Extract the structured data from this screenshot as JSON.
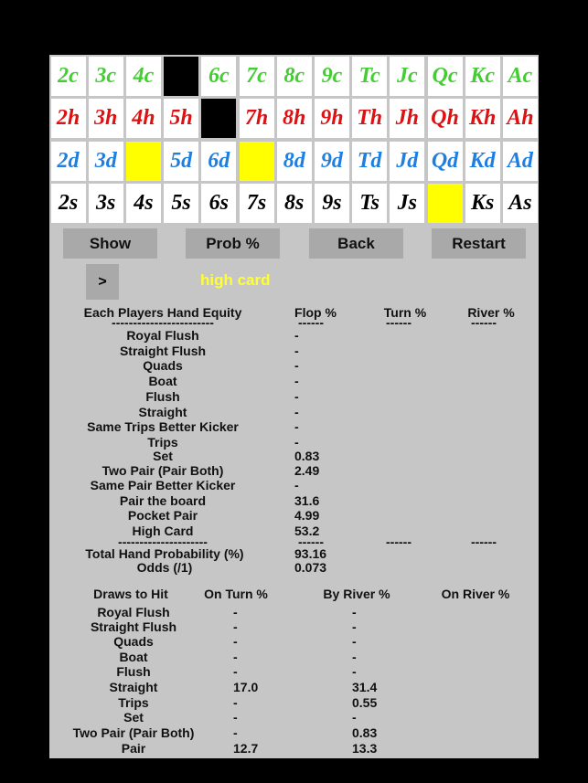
{
  "cards": [
    {
      "label": "2c",
      "color": "#44cc33",
      "state": "normal"
    },
    {
      "label": "3c",
      "color": "#44cc33",
      "state": "normal"
    },
    {
      "label": "4c",
      "color": "#44cc33",
      "state": "normal"
    },
    {
      "label": "",
      "color": "#44cc33",
      "state": "black"
    },
    {
      "label": "6c",
      "color": "#44cc33",
      "state": "normal"
    },
    {
      "label": "7c",
      "color": "#44cc33",
      "state": "normal"
    },
    {
      "label": "8c",
      "color": "#44cc33",
      "state": "normal"
    },
    {
      "label": "9c",
      "color": "#44cc33",
      "state": "normal"
    },
    {
      "label": "Tc",
      "color": "#44cc33",
      "state": "normal"
    },
    {
      "label": "Jc",
      "color": "#44cc33",
      "state": "normal"
    },
    {
      "label": "Qc",
      "color": "#44cc33",
      "state": "normal"
    },
    {
      "label": "Kc",
      "color": "#44cc33",
      "state": "normal"
    },
    {
      "label": "Ac",
      "color": "#44cc33",
      "state": "normal"
    },
    {
      "label": "2h",
      "color": "#dd1111",
      "state": "normal"
    },
    {
      "label": "3h",
      "color": "#dd1111",
      "state": "normal"
    },
    {
      "label": "4h",
      "color": "#dd1111",
      "state": "normal"
    },
    {
      "label": "5h",
      "color": "#dd1111",
      "state": "normal"
    },
    {
      "label": "",
      "color": "#dd1111",
      "state": "black"
    },
    {
      "label": "7h",
      "color": "#dd1111",
      "state": "normal"
    },
    {
      "label": "8h",
      "color": "#dd1111",
      "state": "normal"
    },
    {
      "label": "9h",
      "color": "#dd1111",
      "state": "normal"
    },
    {
      "label": "Th",
      "color": "#dd1111",
      "state": "normal"
    },
    {
      "label": "Jh",
      "color": "#dd1111",
      "state": "normal"
    },
    {
      "label": "Qh",
      "color": "#dd1111",
      "state": "normal"
    },
    {
      "label": "Kh",
      "color": "#dd1111",
      "state": "normal"
    },
    {
      "label": "Ah",
      "color": "#dd1111",
      "state": "normal"
    },
    {
      "label": "2d",
      "color": "#1f7fe0",
      "state": "normal"
    },
    {
      "label": "3d",
      "color": "#1f7fe0",
      "state": "normal"
    },
    {
      "label": "",
      "color": "#1f7fe0",
      "state": "yellow"
    },
    {
      "label": "5d",
      "color": "#1f7fe0",
      "state": "normal"
    },
    {
      "label": "6d",
      "color": "#1f7fe0",
      "state": "normal"
    },
    {
      "label": "",
      "color": "#1f7fe0",
      "state": "yellow"
    },
    {
      "label": "8d",
      "color": "#1f7fe0",
      "state": "normal"
    },
    {
      "label": "9d",
      "color": "#1f7fe0",
      "state": "normal"
    },
    {
      "label": "Td",
      "color": "#1f7fe0",
      "state": "normal"
    },
    {
      "label": "Jd",
      "color": "#1f7fe0",
      "state": "normal"
    },
    {
      "label": "Qd",
      "color": "#1f7fe0",
      "state": "normal"
    },
    {
      "label": "Kd",
      "color": "#1f7fe0",
      "state": "normal"
    },
    {
      "label": "Ad",
      "color": "#1f7fe0",
      "state": "normal"
    },
    {
      "label": "2s",
      "color": "#000000",
      "state": "normal"
    },
    {
      "label": "3s",
      "color": "#000000",
      "state": "normal"
    },
    {
      "label": "4s",
      "color": "#000000",
      "state": "normal"
    },
    {
      "label": "5s",
      "color": "#000000",
      "state": "normal"
    },
    {
      "label": "6s",
      "color": "#000000",
      "state": "normal"
    },
    {
      "label": "7s",
      "color": "#000000",
      "state": "normal"
    },
    {
      "label": "8s",
      "color": "#000000",
      "state": "normal"
    },
    {
      "label": "9s",
      "color": "#000000",
      "state": "normal"
    },
    {
      "label": "Ts",
      "color": "#000000",
      "state": "normal"
    },
    {
      "label": "Js",
      "color": "#000000",
      "state": "normal"
    },
    {
      "label": "",
      "color": "#000000",
      "state": "yellow"
    },
    {
      "label": "Ks",
      "color": "#000000",
      "state": "normal"
    },
    {
      "label": "As",
      "color": "#000000",
      "state": "normal"
    }
  ],
  "buttons": {
    "show": "Show",
    "prob": "Prob %",
    "back": "Back",
    "restart": "Restart",
    "next": ">"
  },
  "hand_name": "high card",
  "equity": {
    "header": "Each Players Hand Equity",
    "flop": "Flop %",
    "turn": "Turn %",
    "river": "River %",
    "underline": "------------------------",
    "dash": "------",
    "rows": [
      {
        "label": "Royal Flush",
        "flop": "-"
      },
      {
        "label": "Straight Flush",
        "flop": "-"
      },
      {
        "label": "Quads",
        "flop": "-"
      },
      {
        "label": "Boat",
        "flop": "-"
      },
      {
        "label": "Flush",
        "flop": "-"
      },
      {
        "label": "Straight",
        "flop": "-"
      },
      {
        "label": "Same Trips Better Kicker",
        "flop": "-"
      },
      {
        "label": "Trips",
        "flop": "-"
      },
      {
        "label": "Set",
        "flop": "0.83"
      },
      {
        "label": "Two Pair (Pair Both)",
        "flop": "2.49"
      },
      {
        "label": "Same Pair Better Kicker",
        "flop": "-"
      },
      {
        "label": "Pair the board",
        "flop": "31.6"
      },
      {
        "label": "Pocket Pair",
        "flop": "4.99"
      },
      {
        "label": "High Card",
        "flop": "53.2"
      }
    ],
    "sep": "---------------------",
    "total_label": "Total Hand Probability (%)",
    "total_flop": "93.16",
    "odds_label": "Odds (/1)",
    "odds_flop": "0.073"
  },
  "draws": {
    "header": "Draws to Hit",
    "on_turn": "On Turn %",
    "by_river": "By River %",
    "on_river": "On River %",
    "rows": [
      {
        "label": "Royal Flush",
        "turn": "-",
        "river": "-"
      },
      {
        "label": "Straight Flush",
        "turn": "-",
        "river": "-"
      },
      {
        "label": "Quads",
        "turn": "-",
        "river": "-"
      },
      {
        "label": "Boat",
        "turn": "-",
        "river": "-"
      },
      {
        "label": "Flush",
        "turn": "-",
        "river": "-"
      },
      {
        "label": "Straight",
        "turn": "17.0",
        "river": "31.4"
      },
      {
        "label": "Trips",
        "turn": "-",
        "river": "0.55"
      },
      {
        "label": "Set",
        "turn": "-",
        "river": "-"
      },
      {
        "label": "Two Pair (Pair Both)",
        "turn": "-",
        "river": "0.83"
      },
      {
        "label": "Pair",
        "turn": "12.7",
        "river": "13.3"
      }
    ]
  }
}
